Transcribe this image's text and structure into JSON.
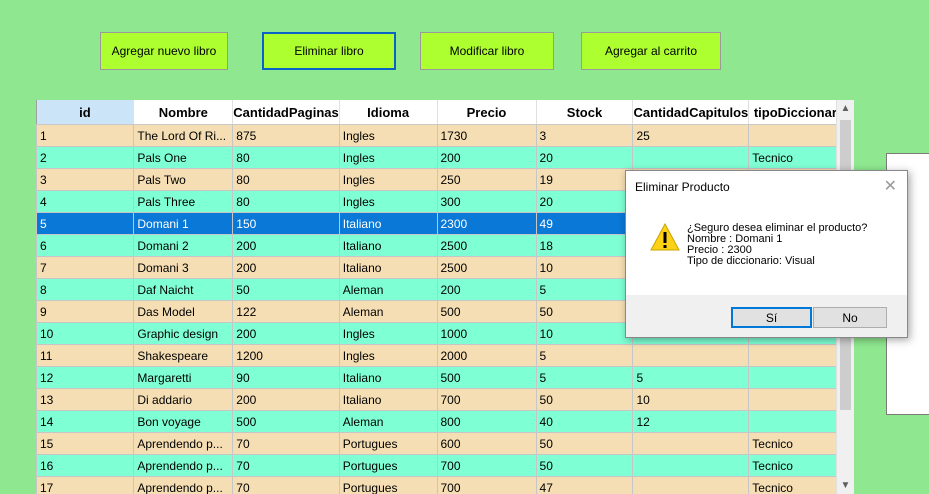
{
  "toolbar": {
    "add_label": "Agregar nuevo libro",
    "delete_label": "Eliminar libro",
    "modify_label": "Modificar libro",
    "cart_label": "Agregar al carrito"
  },
  "grid": {
    "columns": [
      "id",
      "Nombre",
      "CantidadPaginas",
      "Idioma",
      "Precio",
      "Stock",
      "CantidadCapitulos",
      "tipoDiccionario"
    ],
    "rows": [
      [
        "1",
        "The Lord Of Ri...",
        "875",
        "Ingles",
        "1730",
        "3",
        "25",
        ""
      ],
      [
        "2",
        "Pals One",
        "80",
        "Ingles",
        "200",
        "20",
        "",
        "Tecnico"
      ],
      [
        "3",
        "Pals Two",
        "80",
        "Ingles",
        "250",
        "19",
        "",
        ""
      ],
      [
        "4",
        "Pals Three",
        "80",
        "Ingles",
        "300",
        "20",
        "",
        ""
      ],
      [
        "5",
        "Domani 1",
        "150",
        "Italiano",
        "2300",
        "49",
        "",
        ""
      ],
      [
        "6",
        "Domani 2",
        "200",
        "Italiano",
        "2500",
        "18",
        "",
        ""
      ],
      [
        "7",
        "Domani 3",
        "200",
        "Italiano",
        "2500",
        "10",
        "",
        ""
      ],
      [
        "8",
        "Daf Naicht",
        "50",
        "Aleman",
        "200",
        "5",
        "",
        ""
      ],
      [
        "9",
        "Das Model",
        "122",
        "Aleman",
        "500",
        "50",
        "",
        ""
      ],
      [
        "10",
        "Graphic design",
        "200",
        "Ingles",
        "1000",
        "10",
        "",
        ""
      ],
      [
        "11",
        "Shakespeare",
        "1200",
        "Ingles",
        "2000",
        "5",
        "",
        ""
      ],
      [
        "12",
        "Margaretti",
        "90",
        "Italiano",
        "500",
        "5",
        "5",
        ""
      ],
      [
        "13",
        "Di addario",
        "200",
        "Italiano",
        "700",
        "50",
        "10",
        ""
      ],
      [
        "14",
        "Bon voyage",
        "500",
        "Aleman",
        "800",
        "40",
        "12",
        ""
      ],
      [
        "15",
        "Aprendendo p...",
        "70",
        "Portugues",
        "600",
        "50",
        "",
        "Tecnico"
      ],
      [
        "16",
        "Aprendendo p...",
        "70",
        "Portugues",
        "700",
        "50",
        "",
        "Tecnico"
      ],
      [
        "17",
        "Aprendendo p...",
        "70",
        "Portugues",
        "700",
        "47",
        "",
        "Tecnico"
      ]
    ],
    "selected_row_index": 4
  },
  "scrollbar": {
    "up_icon": "chevron-up-icon",
    "down_icon": "chevron-down-icon"
  },
  "dialog": {
    "title": "Eliminar Producto",
    "close_icon": "close-icon",
    "warning_icon": "warning-icon",
    "message_lines": [
      "¿Seguro desea eliminar el producto?",
      "Nombre : Domani 1",
      "Precio : 2300",
      "Tipo de diccionario: Visual"
    ],
    "yes_label": "Sí",
    "no_label": "No"
  },
  "colors": {
    "background": "#8fe88f",
    "button": "#adff2f",
    "row_odd": "#f5deb3",
    "row_even": "#7fffd4",
    "row_selected": "#0a78d7"
  }
}
